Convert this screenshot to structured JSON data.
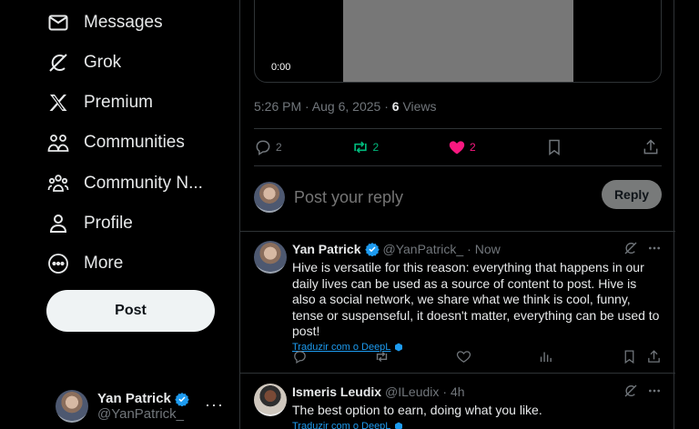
{
  "nav": {
    "messages": "Messages",
    "grok": "Grok",
    "premium": "Premium",
    "communities": "Communities",
    "community_notes": "Community N...",
    "profile": "Profile",
    "more": "More",
    "post_button": "Post"
  },
  "account": {
    "name": "Yan Patrick",
    "handle": "@YanPatrick_",
    "more": "···"
  },
  "post": {
    "video_time": "0:00",
    "timestamp": "5:26 PM · Aug 6, 2025 · ",
    "views_count": "6",
    "views_label": " Views",
    "replies": "2",
    "reposts": "2",
    "likes": "2"
  },
  "reply_composer": {
    "placeholder": "Post your reply",
    "button": "Reply"
  },
  "replies": [
    {
      "name": "Yan Patrick",
      "handle": "@YanPatrick_",
      "time": "· Now",
      "text": "Hive is versatile for this reason: everything that happens in our daily lives can be used as a source of content to post. Hive is also a social network, we share what we think is cool, funny, tense or suspenseful, it doesn't matter, everything can be used to post!",
      "translate": "Traduzir com o DeepL"
    },
    {
      "name": "Ismeris Leudix",
      "handle": "@ILeudix",
      "time": "· 4h",
      "text": "The best option to earn, doing what you like.",
      "translate": "Traduzir com o DeepL"
    }
  ],
  "colors": {
    "background": "#000000",
    "accent": "#1d9bf0",
    "repost": "#00ba7c",
    "like": "#f91880",
    "muted": "#71767b"
  },
  "icons": [
    "envelope-icon",
    "grok-icon",
    "x-logo-icon",
    "communities-icon",
    "community-notes-icon",
    "profile-icon",
    "more-circle-icon",
    "verified-icon",
    "reply-icon",
    "repost-icon",
    "heart-icon",
    "bookmark-icon",
    "share-icon",
    "grok-explain-icon",
    "more-dots-icon",
    "views-icon",
    "deepl-icon"
  ]
}
